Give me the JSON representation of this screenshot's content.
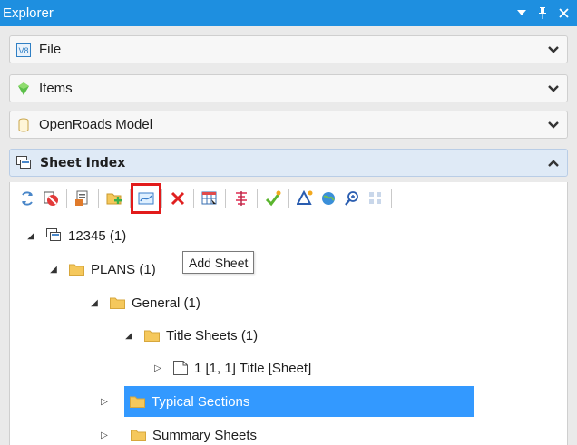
{
  "window": {
    "title": "Explorer",
    "buttons": [
      "dropdown",
      "pin",
      "close"
    ]
  },
  "sections": [
    {
      "label": "File",
      "icon": "v8-file-icon",
      "expanded": false
    },
    {
      "label": "Items",
      "icon": "items-gem-icon",
      "expanded": false
    },
    {
      "label": "OpenRoads Model",
      "icon": "model-cylinder-icon",
      "expanded": false
    },
    {
      "label": "Sheet Index",
      "icon": "sheet-index-icon",
      "expanded": true
    }
  ],
  "toolbar": {
    "buttons": [
      {
        "name": "refresh-button",
        "icon": "refresh-icon"
      },
      {
        "name": "disable-button",
        "icon": "no-entry-icon"
      },
      {
        "name": "properties-button",
        "icon": "properties-icon"
      },
      {
        "name": "add-folder-button",
        "icon": "add-folder-icon"
      },
      {
        "name": "add-sheet-button",
        "icon": "add-sheet-icon",
        "highlighted": true
      },
      {
        "name": "delete-button",
        "icon": "delete-x-icon"
      },
      {
        "name": "table-button",
        "icon": "table-icon"
      },
      {
        "name": "renumber-button",
        "icon": "renumber-icon"
      },
      {
        "name": "validate-button",
        "icon": "checkmark-icon"
      },
      {
        "name": "delta-button",
        "icon": "delta-icon"
      },
      {
        "name": "globe-button",
        "icon": "globe-icon"
      },
      {
        "name": "zoom-button",
        "icon": "zoom-icon"
      },
      {
        "name": "grid-button",
        "icon": "grid-icon"
      }
    ]
  },
  "tooltip": {
    "text": "Add Sheet"
  },
  "tree": [
    {
      "label": "12345 (1)",
      "level": 0,
      "expander": "expanded",
      "icon": "sheet-index-icon"
    },
    {
      "label": "PLANS (1)",
      "level": 1,
      "expander": "expanded",
      "icon": "folder-icon"
    },
    {
      "label": "General (1)",
      "level": 2,
      "expander": "expanded",
      "icon": "folder-icon"
    },
    {
      "label": "Title Sheets (1)",
      "level": 3,
      "expander": "expanded",
      "icon": "folder-icon"
    },
    {
      "label": "1 [1, 1] Title [Sheet]",
      "level": 4,
      "expander": "collapsed",
      "icon": "sheet-icon"
    },
    {
      "label": "Typical Sections",
      "level": 3,
      "expander": "collapsed",
      "icon": "folder-icon",
      "selected": true
    },
    {
      "label": "Summary Sheets",
      "level": 3,
      "expander": "collapsed",
      "icon": "folder-icon"
    }
  ],
  "colors": {
    "titlebar": "#1e8fe0",
    "selection": "#3399ff",
    "highlight_outline": "#e21b1b",
    "folder": "#f5c85c"
  }
}
